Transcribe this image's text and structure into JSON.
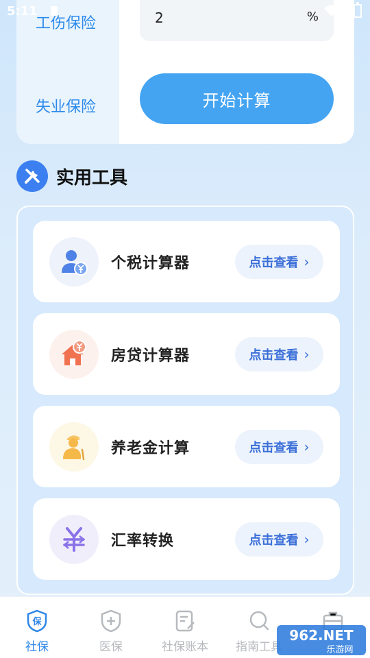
{
  "status_bar": {
    "time": "5:11"
  },
  "calculator": {
    "labels": [
      "工伤保险",
      "失业保险"
    ],
    "injury_input_value": "2",
    "unit": "%",
    "start_button_label": "开始计算"
  },
  "tools_section": {
    "title": "实用工具",
    "items": [
      {
        "name": "个税计算器",
        "action": "点击查看",
        "icon": "person-yuan-icon",
        "icon_bg": "#eef2fb"
      },
      {
        "name": "房贷计算器",
        "action": "点击查看",
        "icon": "house-yuan-icon",
        "icon_bg": "#fdf1ee"
      },
      {
        "name": "养老金计算",
        "action": "点击查看",
        "icon": "elderly-person-icon",
        "icon_bg": "#fdf7e6"
      },
      {
        "name": "汇率转换",
        "action": "点击查看",
        "icon": "currency-exchange-icon",
        "icon_bg": "#f1eefc"
      }
    ]
  },
  "bottom_nav": {
    "items": [
      {
        "label": "社保",
        "icon": "shield-bao-icon",
        "active": true
      },
      {
        "label": "医保",
        "icon": "medical-shield-icon",
        "active": false
      },
      {
        "label": "社保账本",
        "icon": "notebook-icon",
        "active": false
      },
      {
        "label": "指南工具",
        "icon": "search-icon",
        "active": false
      },
      {
        "label": "",
        "icon": "toolbox-icon",
        "active": false
      }
    ]
  },
  "watermark": {
    "text": "962.NET",
    "sub": "乐游网"
  },
  "colors": {
    "accent": "#44a4f2",
    "label_blue": "#2d8bea",
    "nav_active": "#2f86e8",
    "section_icon": "#3c7ff0"
  }
}
